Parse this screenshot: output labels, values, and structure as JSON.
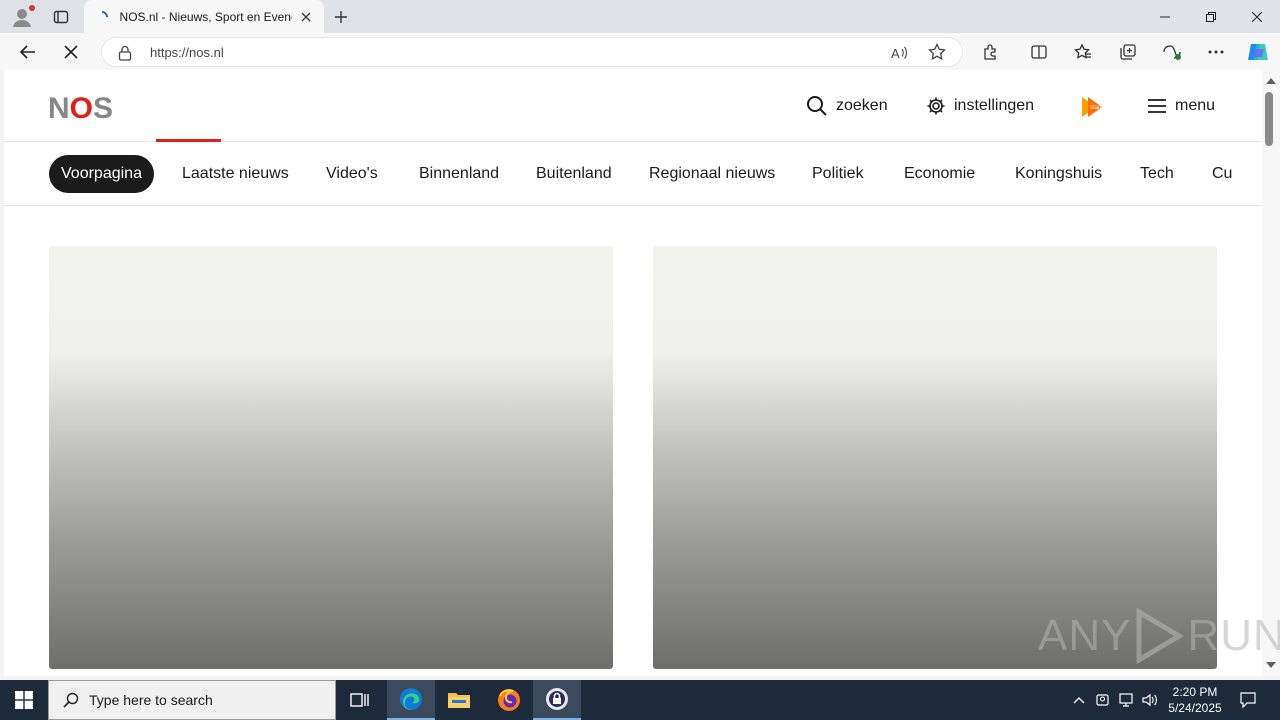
{
  "browser": {
    "tab_title": "NOS.nl - Nieuws, Sport en Evenementen",
    "url": "https://nos.nl"
  },
  "site": {
    "logo_n": "N",
    "logo_o": "O",
    "logo_s": "S",
    "header": {
      "search_label": "zoeken",
      "settings_label": "instellingen",
      "menu_label": "menu",
      "npo_badge": "start"
    },
    "nav": [
      {
        "label": "Voorpagina",
        "active": true
      },
      {
        "label": "Laatste nieuws"
      },
      {
        "label": "Video's"
      },
      {
        "label": "Binnenland"
      },
      {
        "label": "Buitenland"
      },
      {
        "label": "Regionaal nieuws"
      },
      {
        "label": "Politiek"
      },
      {
        "label": "Economie"
      },
      {
        "label": "Koningshuis"
      },
      {
        "label": "Tech"
      },
      {
        "label": "Cu"
      }
    ]
  },
  "watermark": {
    "left": "ANY",
    "right": "RUN"
  },
  "taskbar": {
    "search_placeholder": "Type here to search",
    "time": "2:20 PM",
    "date": "5/24/2025"
  },
  "colors": {
    "nos_red": "#e61e14",
    "logo_grey": "#868686",
    "nav_active_bg": "#1b1b1b",
    "taskbar_bg": "#1c2a3a"
  }
}
